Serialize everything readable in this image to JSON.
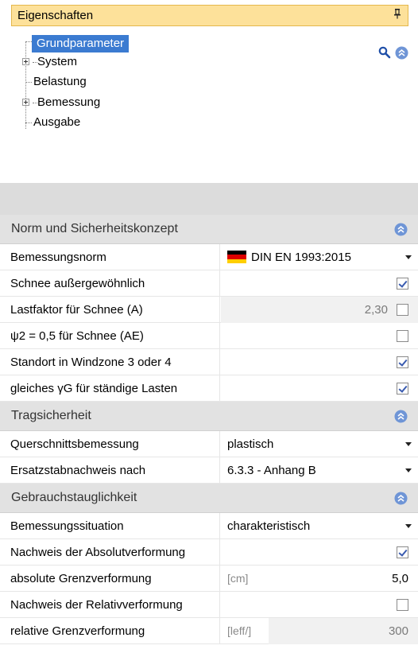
{
  "panel": {
    "title": "Eigenschaften",
    "pin_glyph": "ф"
  },
  "tree": {
    "items": [
      {
        "label": "Grundparameter",
        "selected": true,
        "expandable": false
      },
      {
        "label": "System",
        "selected": false,
        "expandable": true
      },
      {
        "label": "Belastung",
        "selected": false,
        "expandable": false
      },
      {
        "label": "Bemessung",
        "selected": false,
        "expandable": true
      },
      {
        "label": "Ausgabe",
        "selected": false,
        "expandable": false
      }
    ],
    "tools": {
      "search": "search-icon",
      "collapse": "collapse-all-icon"
    }
  },
  "sections": [
    {
      "title": "Norm und Sicherheitskonzept",
      "rows": [
        {
          "label": "Bemessungsnorm",
          "value": "DIN EN 1993:2015",
          "kind": "dropdown",
          "flag": "germany"
        },
        {
          "label": "Schnee außergewöhnlich",
          "kind": "checkbox",
          "checked": true
        },
        {
          "label": "Lastfaktor für Schnee (A)",
          "number": "2,30",
          "kind": "number-checkbox",
          "checked": false,
          "disabled": true
        },
        {
          "label": " ψ2 = 0,5 für Schnee (AE)",
          "kind": "checkbox",
          "checked": false
        },
        {
          "label": "Standort in Windzone 3 oder 4",
          "kind": "checkbox",
          "checked": true
        },
        {
          "label": "gleiches γG für ständige Lasten",
          "kind": "checkbox",
          "checked": true
        }
      ]
    },
    {
      "title": "Tragsicherheit",
      "rows": [
        {
          "label": "Querschnittsbemessung",
          "value": "plastisch",
          "kind": "dropdown"
        },
        {
          "label": "Ersatzstabnachweis nach",
          "value": "6.3.3 - Anhang B",
          "kind": "dropdown"
        }
      ]
    },
    {
      "title": "Gebrauchstauglichkeit",
      "rows": [
        {
          "label": "Bemessungssituation",
          "value": "charakteristisch",
          "kind": "dropdown"
        },
        {
          "label": "Nachweis der Absolutverformung",
          "kind": "checkbox",
          "checked": true
        },
        {
          "label": "absolute Grenzverformung",
          "unit": "[cm]",
          "number": "5,0",
          "kind": "number"
        },
        {
          "label": "Nachweis der Relativverformung",
          "kind": "checkbox",
          "checked": false
        },
        {
          "label": "relative Grenzverformung",
          "unit": "[leff/]",
          "number": "300",
          "kind": "number",
          "disabled": true
        }
      ]
    }
  ],
  "colors": {
    "header_bg": "#fde19a",
    "selection": "#3b7bd1",
    "section_bg": "#e2e2e2",
    "check": "#3b5cb0"
  }
}
